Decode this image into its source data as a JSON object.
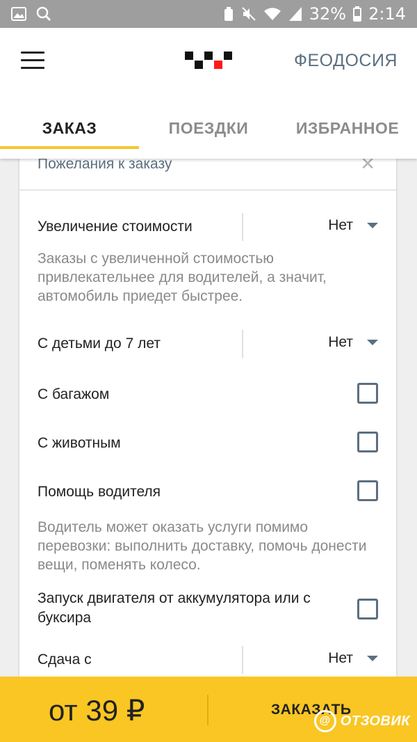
{
  "status_bar": {
    "battery": "32%",
    "time": "2:14",
    "icons_left": [
      "image-icon",
      "search-icon"
    ],
    "icons_right": [
      "recycle-icon",
      "mute-icon",
      "wifi-icon",
      "signal-icon"
    ]
  },
  "header": {
    "city": "ФЕОДОСИЯ",
    "tabs": [
      {
        "label": "ЗАКАЗ",
        "active": true
      },
      {
        "label": "ПОЕЗДКИ",
        "active": false
      },
      {
        "label": "ИЗБРАННОЕ",
        "active": false
      }
    ],
    "accent_color": "#f7c52b"
  },
  "card": {
    "title": "Пожелания к заказу",
    "close": "✕",
    "rows": [
      {
        "label": "Увеличение стоимости",
        "type": "select",
        "value": "Нет"
      },
      {
        "hint": "Заказы с увеличенной стоимостью привлекательнее для водителей, а значит, автомобиль приедет быстрее."
      },
      {
        "label": "С детьми до 7 лет",
        "type": "select",
        "value": "Нет"
      },
      {
        "label": "С багажом",
        "type": "checkbox",
        "checked": false
      },
      {
        "label": "С животным",
        "type": "checkbox",
        "checked": false
      },
      {
        "label": "Помощь водителя",
        "type": "checkbox",
        "checked": false
      },
      {
        "hint": "Водитель может оказать услуги помимо перевозки: выполнить доставку, помочь донести вещи, поменять колесо."
      },
      {
        "label": "Запуск двигателя от аккумулятора или с буксира",
        "type": "checkbox",
        "checked": false
      },
      {
        "label": "Сдача с",
        "type": "select",
        "value": "Нет"
      }
    ]
  },
  "bottom_bar": {
    "price": "от 39 ₽",
    "order_label": "ЗАКАЗАТЬ",
    "bar_color": "#f9c623"
  },
  "watermark": {
    "text": "ОТЗОВИК",
    "badge": "@"
  }
}
